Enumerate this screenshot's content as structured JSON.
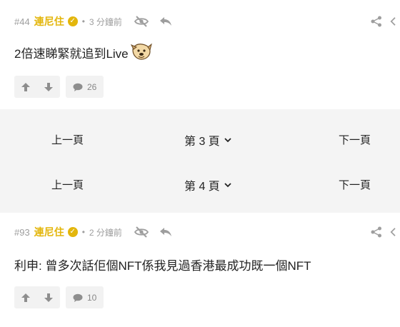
{
  "posts": [
    {
      "floor": "#44",
      "author": "連尼住",
      "dot": "•",
      "time": "3 分鐘前",
      "content": "2倍速睇緊就追到Live",
      "comment_count": "26"
    },
    {
      "floor": "#93",
      "author": "連尼住",
      "dot": "•",
      "time": "2 分鐘前",
      "content": "利申: 曾多次話佢個NFT係我見過香港最成功既一個NFT",
      "comment_count": "10"
    }
  ],
  "pagination": [
    {
      "prev": "上一頁",
      "page": "第 3 頁",
      "next": "下一頁"
    },
    {
      "prev": "上一頁",
      "page": "第 4 頁",
      "next": "下一頁"
    }
  ],
  "icons": {
    "verified": "verified-badge-icon",
    "hide": "eye-slash-icon",
    "reply": "reply-arrow-icon",
    "share": "share-icon",
    "upvote": "thumb-up-arrow-icon",
    "downvote": "thumb-down-arrow-icon",
    "comments": "comment-bubble-icon",
    "dropdown": "chevron-down-icon"
  },
  "colors": {
    "author": "#e3b60c",
    "meta": "#9e9e9e",
    "pager_bg": "#f4f4f4",
    "button_bg": "#f2f2f2"
  }
}
